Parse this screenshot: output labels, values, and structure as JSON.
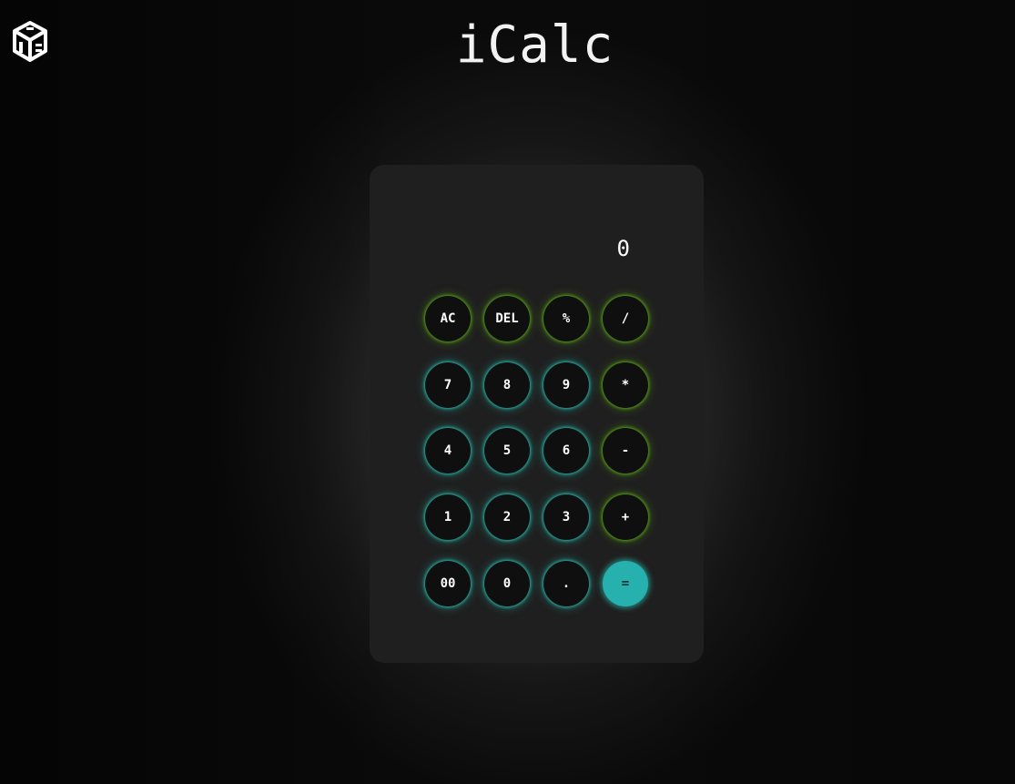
{
  "app": {
    "title": "iCalc",
    "logo_icon": "cube-logo-icon"
  },
  "display": {
    "value": "0"
  },
  "keys": {
    "ac": "AC",
    "del": "DEL",
    "percent": "%",
    "divide": "/",
    "seven": "7",
    "eight": "8",
    "nine": "9",
    "multiply": "*",
    "four": "4",
    "five": "5",
    "six": "6",
    "subtract": "-",
    "one": "1",
    "two": "2",
    "three": "3",
    "add": "+",
    "double_zero": "00",
    "zero": "0",
    "decimal": ".",
    "equals": "="
  },
  "colors": {
    "operator_glow": "#5caa14",
    "number_glow": "#28c8b9",
    "equals_fill": "#26b0ae",
    "panel": "#1f1f1f"
  }
}
